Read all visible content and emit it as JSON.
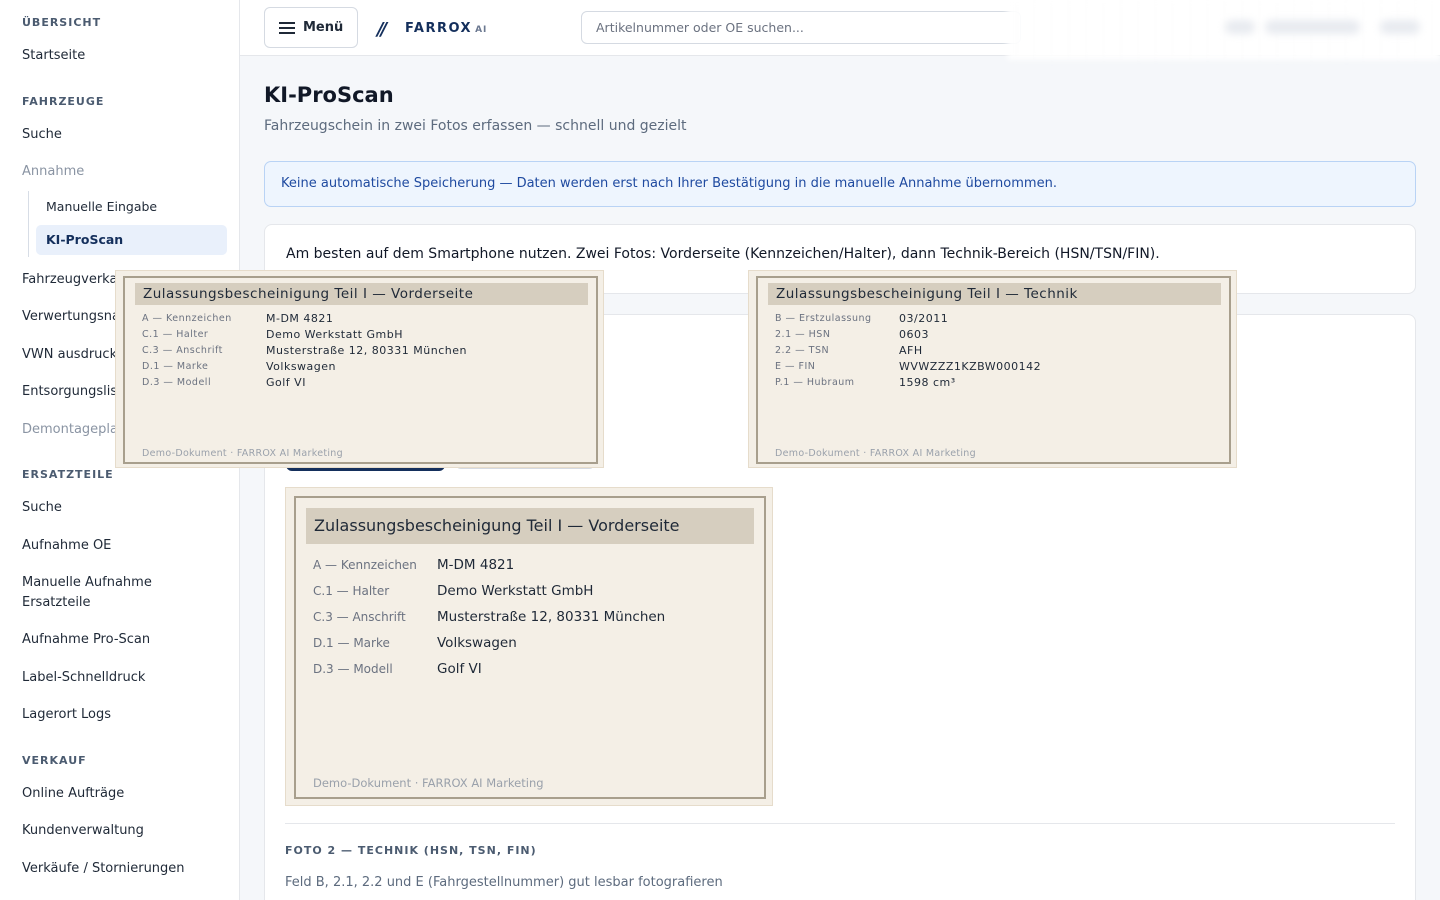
{
  "sidebar": {
    "sections": {
      "uebersicht": "ÜBERSICHT",
      "fahrzeuge": "FAHRZEUGE",
      "ersatzteile": "ERSATZTEILE",
      "verkauf": "VERKAUF"
    },
    "items": {
      "startseite": "Startseite",
      "fz_suche": "Suche",
      "annahme": "Annahme",
      "manuelle_eingabe": "Manuelle Eingabe",
      "ki_proscan": "KI-ProScan",
      "fahrzeugverkauf": "Fahrzeugverka",
      "verwertungsnachweis": "Verwertungsna",
      "vwn_ausdruck": "VWN ausdruck",
      "entsorgungsliste": "Entsorgungslis",
      "demontageplan": "Demontagepla",
      "et_suche": "Suche",
      "aufnahme_oe": "Aufnahme OE",
      "manuelle_aufnahme": "Manuelle Aufnahme Ersatzteile",
      "aufnahme_proscan": "Aufnahme Pro-Scan",
      "label_druck": "Label-Schnelldruck",
      "lagerort_logs": "Lagerort Logs",
      "online_auftraege": "Online Aufträge",
      "kundenverwaltung": "Kundenverwaltung",
      "verkaeufe": "Verkäufe / Stornierungen"
    }
  },
  "header": {
    "menu_label": "Menü",
    "brand": "FARROX",
    "brand_suffix": "AI",
    "search_placeholder": "Artikelnummer oder OE suchen..."
  },
  "main": {
    "title": "KI-ProScan",
    "subtitle": "Fahrzeugschein in zwei Fotos erfassen — schnell und gezielt",
    "info": "Keine automatische Speicherung — Daten werden erst nach Ihrer Bestätigung in die manuelle Annahme übernommen.",
    "hint": "Am besten auf dem Smartphone nutzen. Zwei Fotos: Vorderseite (Kennzeichen/Halter), dann Technik-Bereich (HSN/TSN/FIN).",
    "foto2_title": "FOTO 2 — TECHNIK (HSN, TSN, FIN)",
    "foto2_desc": "Feld B, 2.1, 2.2 und E (Fahrgestellnummer) gut lesbar fotografieren"
  },
  "docs": {
    "front": {
      "title": "Zulassungsbescheinigung Teil I — Vorderseite",
      "rows": [
        {
          "k": "A — Kennzeichen",
          "v": "M-DM 4821"
        },
        {
          "k": "C.1 — Halter",
          "v": "Demo Werkstatt GmbH"
        },
        {
          "k": "C.3 — Anschrift",
          "v": "Musterstraße 12, 80331 München"
        },
        {
          "k": "D.1 — Marke",
          "v": "Volkswagen"
        },
        {
          "k": "D.3 — Modell",
          "v": "Golf VI"
        }
      ],
      "footer": "Demo-Dokument · FARROX AI Marketing"
    },
    "tech": {
      "title": "Zulassungsbescheinigung Teil I — Technik",
      "rows": [
        {
          "k": "B — Erstzulassung",
          "v": "03/2011"
        },
        {
          "k": "2.1 — HSN",
          "v": "0603"
        },
        {
          "k": "2.2 — TSN",
          "v": "AFH"
        },
        {
          "k": "E — FIN",
          "v": "WVWZZZ1KZBW000142"
        },
        {
          "k": "P.1 — Hubraum",
          "v": "1598 cm³"
        }
      ],
      "footer": "Demo-Dokument · FARROX AI Marketing"
    }
  }
}
